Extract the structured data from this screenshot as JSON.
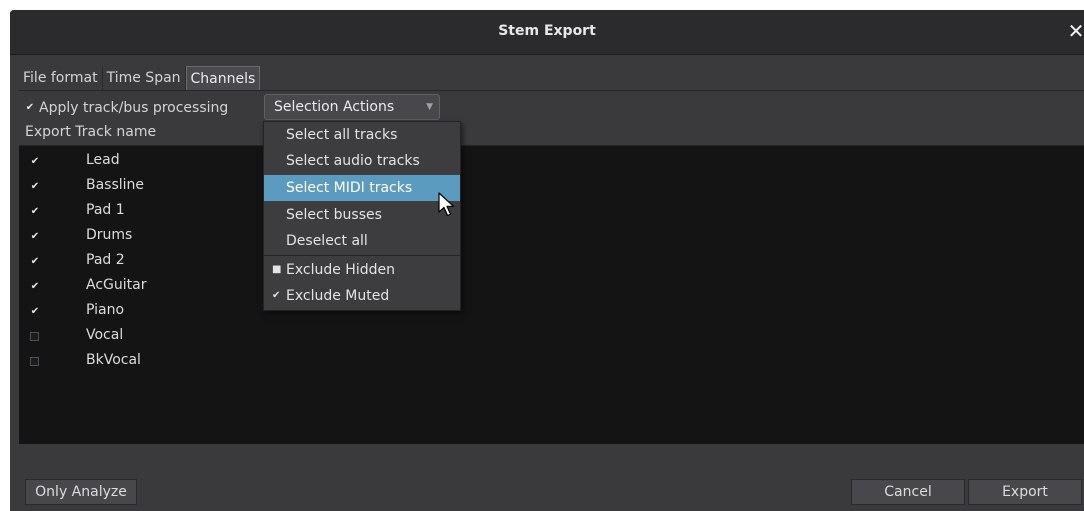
{
  "window": {
    "title": "Stem Export",
    "close_glyph": "✕"
  },
  "tabs": [
    {
      "label": "File format",
      "active": false
    },
    {
      "label": "Time Span",
      "active": false
    },
    {
      "label": "Channels",
      "active": true
    }
  ],
  "options": {
    "apply_processing_label": "Apply track/bus processing",
    "apply_processing_checked": true,
    "selection_actions_label": "Selection Actions"
  },
  "list": {
    "headers": [
      "Export",
      "Track name"
    ],
    "tracks": [
      {
        "name": "Lead",
        "export": true
      },
      {
        "name": "Bassline",
        "export": true
      },
      {
        "name": "Pad 1",
        "export": true
      },
      {
        "name": "Drums",
        "export": true
      },
      {
        "name": "Pad 2",
        "export": true
      },
      {
        "name": "AcGuitar",
        "export": true
      },
      {
        "name": "Piano",
        "export": true
      },
      {
        "name": "Vocal",
        "export": false
      },
      {
        "name": "BkVocal",
        "export": false
      }
    ]
  },
  "menu": {
    "items": [
      {
        "label": "Select all tracks",
        "highlighted": false
      },
      {
        "label": "Select audio tracks",
        "highlighted": false
      },
      {
        "label": "Select MIDI tracks",
        "highlighted": true
      },
      {
        "label": "Select busses",
        "highlighted": false
      },
      {
        "label": "Deselect all",
        "highlighted": false
      }
    ],
    "toggles": [
      {
        "label": "Exclude Hidden",
        "checked": false
      },
      {
        "label": "Exclude Muted",
        "checked": true
      }
    ]
  },
  "buttons": {
    "only_analyze": "Only Analyze",
    "cancel": "Cancel",
    "export": "Export"
  },
  "colors": {
    "highlight": "#5b9bbf",
    "background": "#3a3a3d",
    "list_background": "#141415"
  },
  "icons": {
    "check": "✔",
    "dropdown": "▼"
  }
}
